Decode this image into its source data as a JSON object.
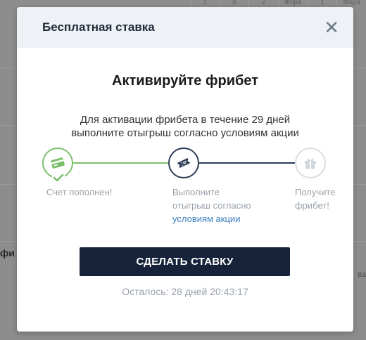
{
  "background": {
    "header_cells": [
      "1",
      "X",
      "2",
      "Фора",
      "1",
      "Фора"
    ],
    "left_text": "фи",
    "right_text": "ва"
  },
  "modal": {
    "title": "Бесплатная ставка",
    "close_symbol": "✕",
    "heading": "Активируйте фрибет",
    "description_line1": "Для активации фрибета в течение 29 дней",
    "description_line2": "выполните отыгрыш согласно условиям акции",
    "steps": [
      {
        "line1": "Счет пополнен!",
        "line2": "",
        "icon": "card-icon",
        "status": "done"
      },
      {
        "line1": "Выполните",
        "line2": "отыгрыш согласно",
        "link": "условиям акции",
        "icon": "ticket-icon",
        "status": "active"
      },
      {
        "line1": "Получите",
        "line2": "фрибет!",
        "icon": "gift-icon",
        "status": "pending"
      }
    ],
    "button_label": "СДЕЛАТЬ СТАВКУ",
    "timer_prefix": "Осталось:",
    "timer_value": "28 дней 20:43:17"
  },
  "colors": {
    "done": "#7cbf6b",
    "active": "#2c3d55",
    "pending": "#d8dde2",
    "button": "#16213a",
    "link": "#3d7fc0"
  }
}
